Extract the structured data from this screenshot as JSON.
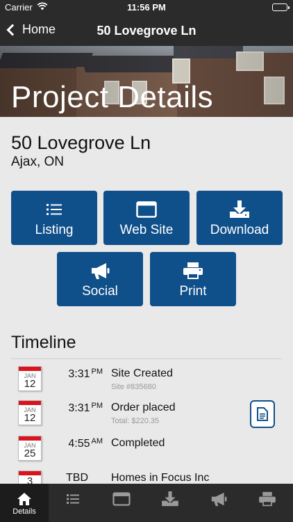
{
  "status_bar": {
    "carrier": "Carrier",
    "time": "11:56 PM",
    "battery_level": 1.0
  },
  "nav": {
    "back_label": "Home",
    "title": "50 Lovegrove Ln"
  },
  "hero": {
    "title": "Project Details"
  },
  "property": {
    "address": "50 Lovegrove Ln",
    "city": "Ajax, ON"
  },
  "actions": {
    "listing": "Listing",
    "website": "Web Site",
    "download": "Download",
    "social": "Social",
    "print": "Print"
  },
  "timeline": {
    "title": "Timeline",
    "rows": [
      {
        "month": "JAN",
        "day": "12",
        "time": "3:31",
        "ampm": "PM",
        "event": "Site Created",
        "sub": "Site #835680"
      },
      {
        "month": "JAN",
        "day": "12",
        "time": "3:31",
        "ampm": "PM",
        "event": "Order placed",
        "sub": "Total: $220.35"
      },
      {
        "month": "JAN",
        "day": "25",
        "time": "4:55",
        "ampm": "AM",
        "event": "Completed",
        "sub": ""
      },
      {
        "month": "",
        "day": "3",
        "time": "TBD",
        "ampm": "",
        "event": "Homes in Focus Inc",
        "sub": ""
      }
    ]
  },
  "tabs": {
    "details": "Details"
  },
  "colors": {
    "accent": "#0f4f8a",
    "bar": "#2b2b2b",
    "calendar_red": "#d9141d"
  }
}
